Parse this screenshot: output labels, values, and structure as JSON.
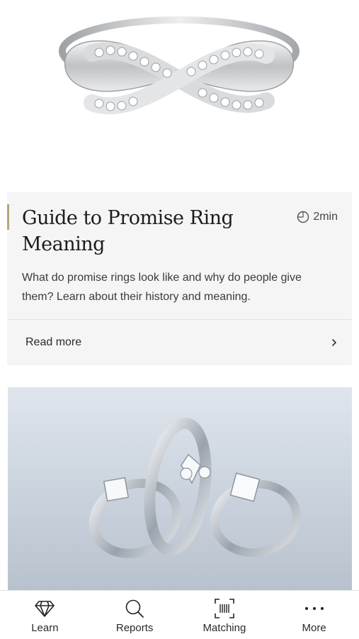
{
  "article": {
    "title": "Guide to Promise Ring Meaning",
    "read_time": "2min",
    "description": "What do promise rings look like and why do people give them? Learn about their history and meaning.",
    "read_more_label": "Read more"
  },
  "tabs": [
    {
      "label": "Learn",
      "icon": "diamond-icon"
    },
    {
      "label": "Reports",
      "icon": "search-icon"
    },
    {
      "label": "Matching",
      "icon": "barcode-scan-icon"
    },
    {
      "label": "More",
      "icon": "more-dots-icon"
    }
  ],
  "colors": {
    "accent": "#b9a27c",
    "card_background": "#f5f5f5"
  }
}
